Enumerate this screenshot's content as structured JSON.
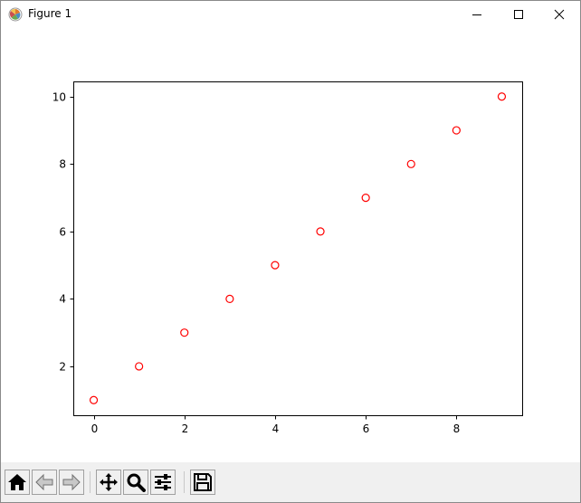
{
  "window": {
    "title": "Figure 1"
  },
  "icons": {
    "app": "matplotlib-icon",
    "minimize": "minimize-icon",
    "maximize": "maximize-icon",
    "close": "close-icon"
  },
  "toolbar": {
    "buttons": [
      {
        "name": "home",
        "icon": "home-icon"
      },
      {
        "name": "back",
        "icon": "arrow-left-icon"
      },
      {
        "name": "forward",
        "icon": "arrow-right-icon"
      },
      {
        "name": "pan",
        "icon": "move-icon"
      },
      {
        "name": "zoom",
        "icon": "magnifier-icon"
      },
      {
        "name": "configure-subplots",
        "icon": "sliders-icon"
      },
      {
        "name": "save",
        "icon": "floppy-disk-icon"
      }
    ]
  },
  "chart_data": {
    "type": "scatter",
    "title": "",
    "xlabel": "",
    "ylabel": "",
    "x": [
      0,
      1,
      2,
      3,
      4,
      5,
      6,
      7,
      8,
      9
    ],
    "y": [
      1,
      2,
      3,
      4,
      5,
      6,
      7,
      8,
      9,
      10
    ],
    "marker": "open-circle",
    "color": "#ff0000",
    "xlim": [
      -0.45,
      9.45
    ],
    "ylim": [
      0.55,
      10.45
    ],
    "xticks": [
      0,
      2,
      4,
      6,
      8
    ],
    "yticks": [
      2,
      4,
      6,
      8,
      10
    ],
    "grid": false
  }
}
